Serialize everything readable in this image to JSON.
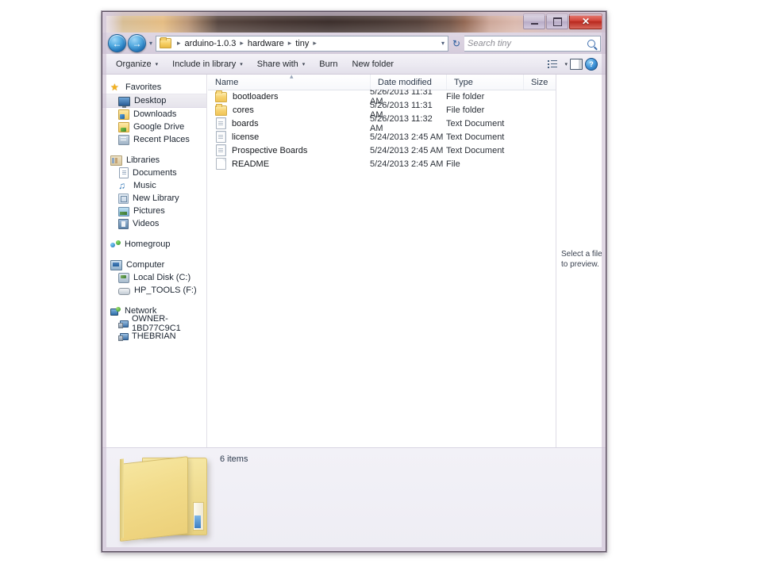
{
  "window": {
    "controls": {
      "minimize": "–",
      "maximize": "□",
      "close": "✕"
    }
  },
  "address_bar": {
    "back": "←",
    "forward": "→",
    "history_caret": "▾",
    "crumbs": [
      "arduino-1.0.3",
      "hardware",
      "tiny"
    ],
    "separator": "▸",
    "dropdown_caret": "▾",
    "refresh": "↻"
  },
  "search": {
    "placeholder": "Search tiny"
  },
  "toolbar": {
    "items": [
      {
        "label": "Organize",
        "caret": "▾"
      },
      {
        "label": "Include in library",
        "caret": "▾"
      },
      {
        "label": "Share with",
        "caret": "▾"
      },
      {
        "label": "Burn",
        "caret": ""
      },
      {
        "label": "New folder",
        "caret": ""
      }
    ],
    "views_caret": "▾",
    "help_label": "?"
  },
  "navigation_pane": {
    "groups": [
      {
        "header": {
          "label": "Favorites",
          "icon": "star-icon"
        },
        "items": [
          {
            "label": "Desktop",
            "icon": "desktop-icon",
            "selected": true
          },
          {
            "label": "Downloads",
            "icon": "downloads-icon",
            "selected": false
          },
          {
            "label": "Google Drive",
            "icon": "google-drive-icon",
            "selected": false
          },
          {
            "label": "Recent Places",
            "icon": "recent-places-icon",
            "selected": false
          }
        ]
      },
      {
        "header": {
          "label": "Libraries",
          "icon": "libraries-icon"
        },
        "items": [
          {
            "label": "Documents",
            "icon": "documents-icon",
            "selected": false
          },
          {
            "label": "Music",
            "icon": "music-icon",
            "selected": false
          },
          {
            "label": "New Library",
            "icon": "new-library-icon",
            "selected": false
          },
          {
            "label": "Pictures",
            "icon": "pictures-icon",
            "selected": false
          },
          {
            "label": "Videos",
            "icon": "videos-icon",
            "selected": false
          }
        ]
      },
      {
        "header": {
          "label": "Homegroup",
          "icon": "homegroup-icon"
        },
        "items": []
      },
      {
        "header": {
          "label": "Computer",
          "icon": "computer-icon"
        },
        "items": [
          {
            "label": "Local Disk (C:)",
            "icon": "local-disk-icon",
            "selected": false
          },
          {
            "label": "HP_TOOLS (F:)",
            "icon": "usb-drive-icon",
            "selected": false
          }
        ]
      },
      {
        "header": {
          "label": "Network",
          "icon": "network-icon"
        },
        "items": [
          {
            "label": "OWNER-1BD77C9C1",
            "icon": "computer-node-icon",
            "selected": false
          },
          {
            "label": "THEBRIAN",
            "icon": "computer-node-icon",
            "selected": false
          }
        ]
      }
    ]
  },
  "file_list": {
    "columns": [
      "Name",
      "Date modified",
      "Type",
      "Size"
    ],
    "sort_indicator": "▴",
    "rows": [
      {
        "name": "bootloaders",
        "date": "5/26/2013 11:31 AM",
        "type": "File folder",
        "size": "",
        "icon": "folder-icon"
      },
      {
        "name": "cores",
        "date": "5/26/2013 11:31 AM",
        "type": "File folder",
        "size": "",
        "icon": "folder-icon"
      },
      {
        "name": "boards",
        "date": "5/26/2013 11:32 AM",
        "type": "Text Document",
        "size": "",
        "icon": "text-document-icon"
      },
      {
        "name": "license",
        "date": "5/24/2013 2:45 AM",
        "type": "Text Document",
        "size": "",
        "icon": "text-document-icon"
      },
      {
        "name": "Prospective Boards",
        "date": "5/24/2013 2:45 AM",
        "type": "Text Document",
        "size": "",
        "icon": "text-document-icon"
      },
      {
        "name": "README",
        "date": "5/24/2013 2:45 AM",
        "type": "File",
        "size": "",
        "icon": "blank-file-icon"
      }
    ],
    "scroll_left_arrow": "◂",
    "scroll_right_arrow": "▸",
    "scroll_thumb_grip": "⋯"
  },
  "preview_pane": {
    "message": "Select a file to preview."
  },
  "status_bar": {
    "item_count": "6 items"
  },
  "colors": {
    "accent": "#3d7fc4",
    "folder_yellow": "#f2dc8c",
    "close_red": "#d2453b",
    "window_chrome": "#d4cbdb"
  }
}
